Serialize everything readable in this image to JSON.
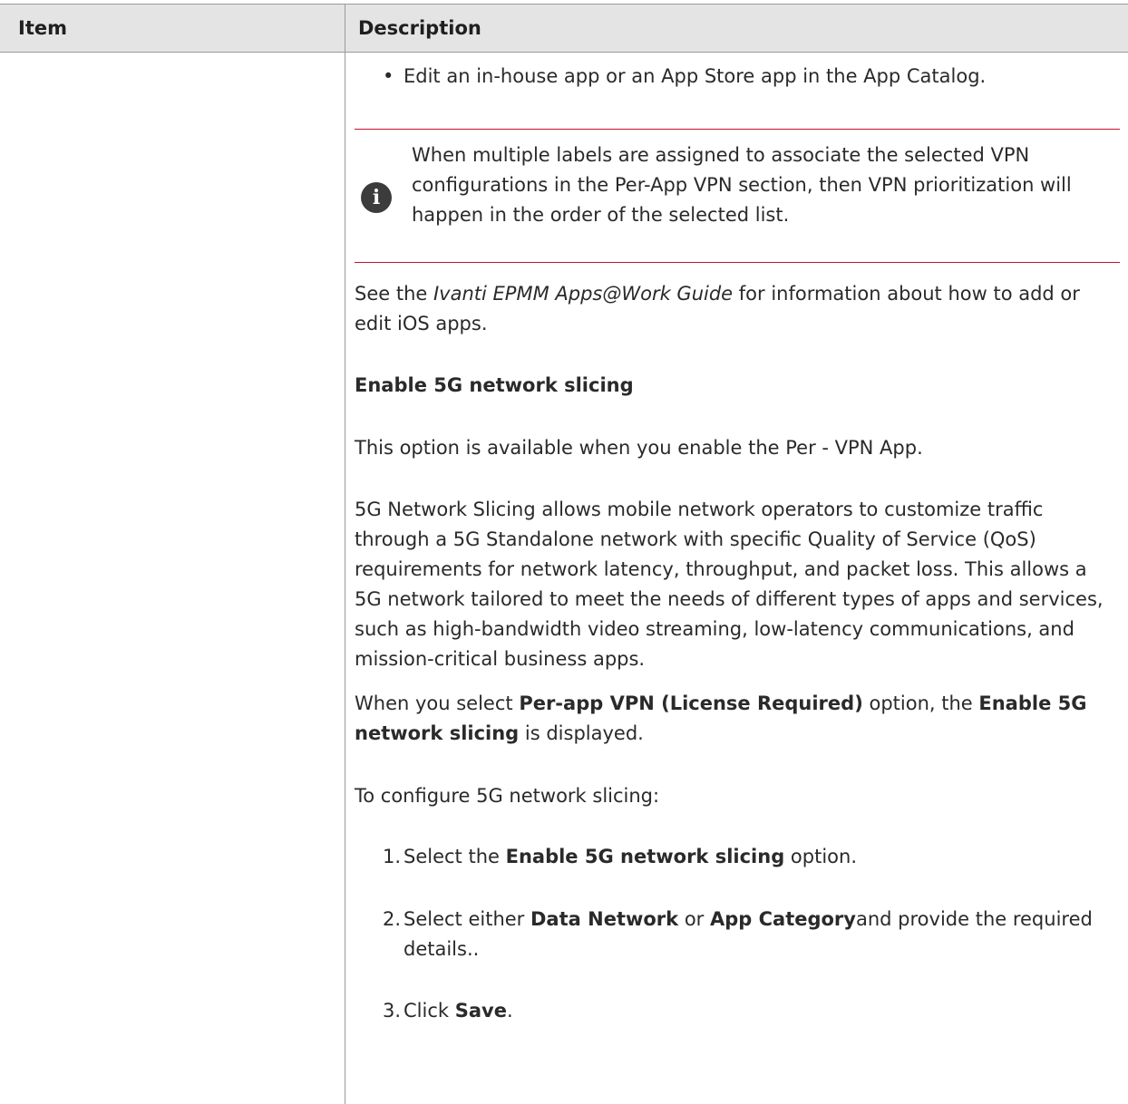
{
  "table": {
    "header_item": "Item",
    "header_description": "Description"
  },
  "description": {
    "bullet_text": "Edit an in-house app or an App Store app in the App Catalog.",
    "note": {
      "icon": "info-icon",
      "icon_glyph": "i",
      "text": "When multiple labels are assigned to associate the selected VPN configurations in the Per-App VPN section, then VPN prioritization will happen in the order of the selected list."
    },
    "see_guide": {
      "prefix": "See the ",
      "guide_title": "Ivanti EPMM Apps@Work Guide",
      "suffix": " for information about how to add or edit iOS apps."
    },
    "section_heading": "Enable 5G network slicing",
    "availability_text": "This option is available when you enable the Per - VPN App.",
    "slicing_description": "5G Network Slicing allows mobile network operators to customize traffic through a 5G Standalone network with specific Quality of Service (QoS) requirements for network latency, throughput, and packet loss. This allows a 5G network tailored to meet the needs of different types of apps and services, such as high-bandwidth video streaming, low-latency communications, and mission-critical business apps.",
    "when_select": {
      "prefix": "When you select ",
      "option": "Per-app VPN (License Required)",
      "middle": " option, the ",
      "setting": "Enable 5G network slicing",
      "suffix": " is displayed."
    },
    "configure_intro": "To configure 5G network slicing:",
    "steps": [
      {
        "number": "1.",
        "prefix": "Select the ",
        "bold": "Enable 5G network slicing",
        "suffix": " option."
      },
      {
        "number": "2.",
        "prefix": "Select either ",
        "bold": "Data Network",
        "middle": " or ",
        "bold2": "App Category",
        "suffix": "and provide the required details.."
      },
      {
        "number": "3.",
        "prefix": "Click ",
        "bold": "Save",
        "suffix": "."
      }
    ],
    "colors": {
      "header_background": "#e4e4e4",
      "note_rule": "#c8102e",
      "note_icon": "#3c3c3c"
    }
  }
}
